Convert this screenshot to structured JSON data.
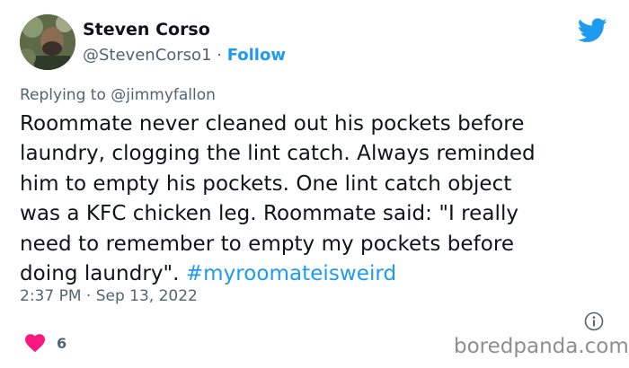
{
  "tweet": {
    "author_name": "Steven Corso",
    "author_handle": "@StevenCorso1",
    "separator": " · ",
    "follow_label": "Follow",
    "replying_prefix": "Replying to ",
    "replying_to": "@jimmyfallon",
    "body_lines": [
      "Roommate never cleaned out his pockets before",
      "laundry, clogging the lint catch. Always reminded",
      "him to empty his pockets. One lint catch object",
      "was a KFC chicken leg. Roommate said: \"I really",
      "need to remember to empty my pockets before",
      "doing laundry\". "
    ],
    "hashtag": "#myroomateisweird",
    "timestamp": "2:37 PM · Sep 13, 2022",
    "like_count": "6"
  },
  "icons": {
    "platform": "twitter-bird-icon",
    "info": "info-icon",
    "like": "heart-icon"
  },
  "colors": {
    "link_blue": "#1d9bf0",
    "muted_gray": "#536471",
    "heart_pink": "#f91880",
    "text_dark": "#0f1419"
  },
  "watermark": "boredpanda.com"
}
